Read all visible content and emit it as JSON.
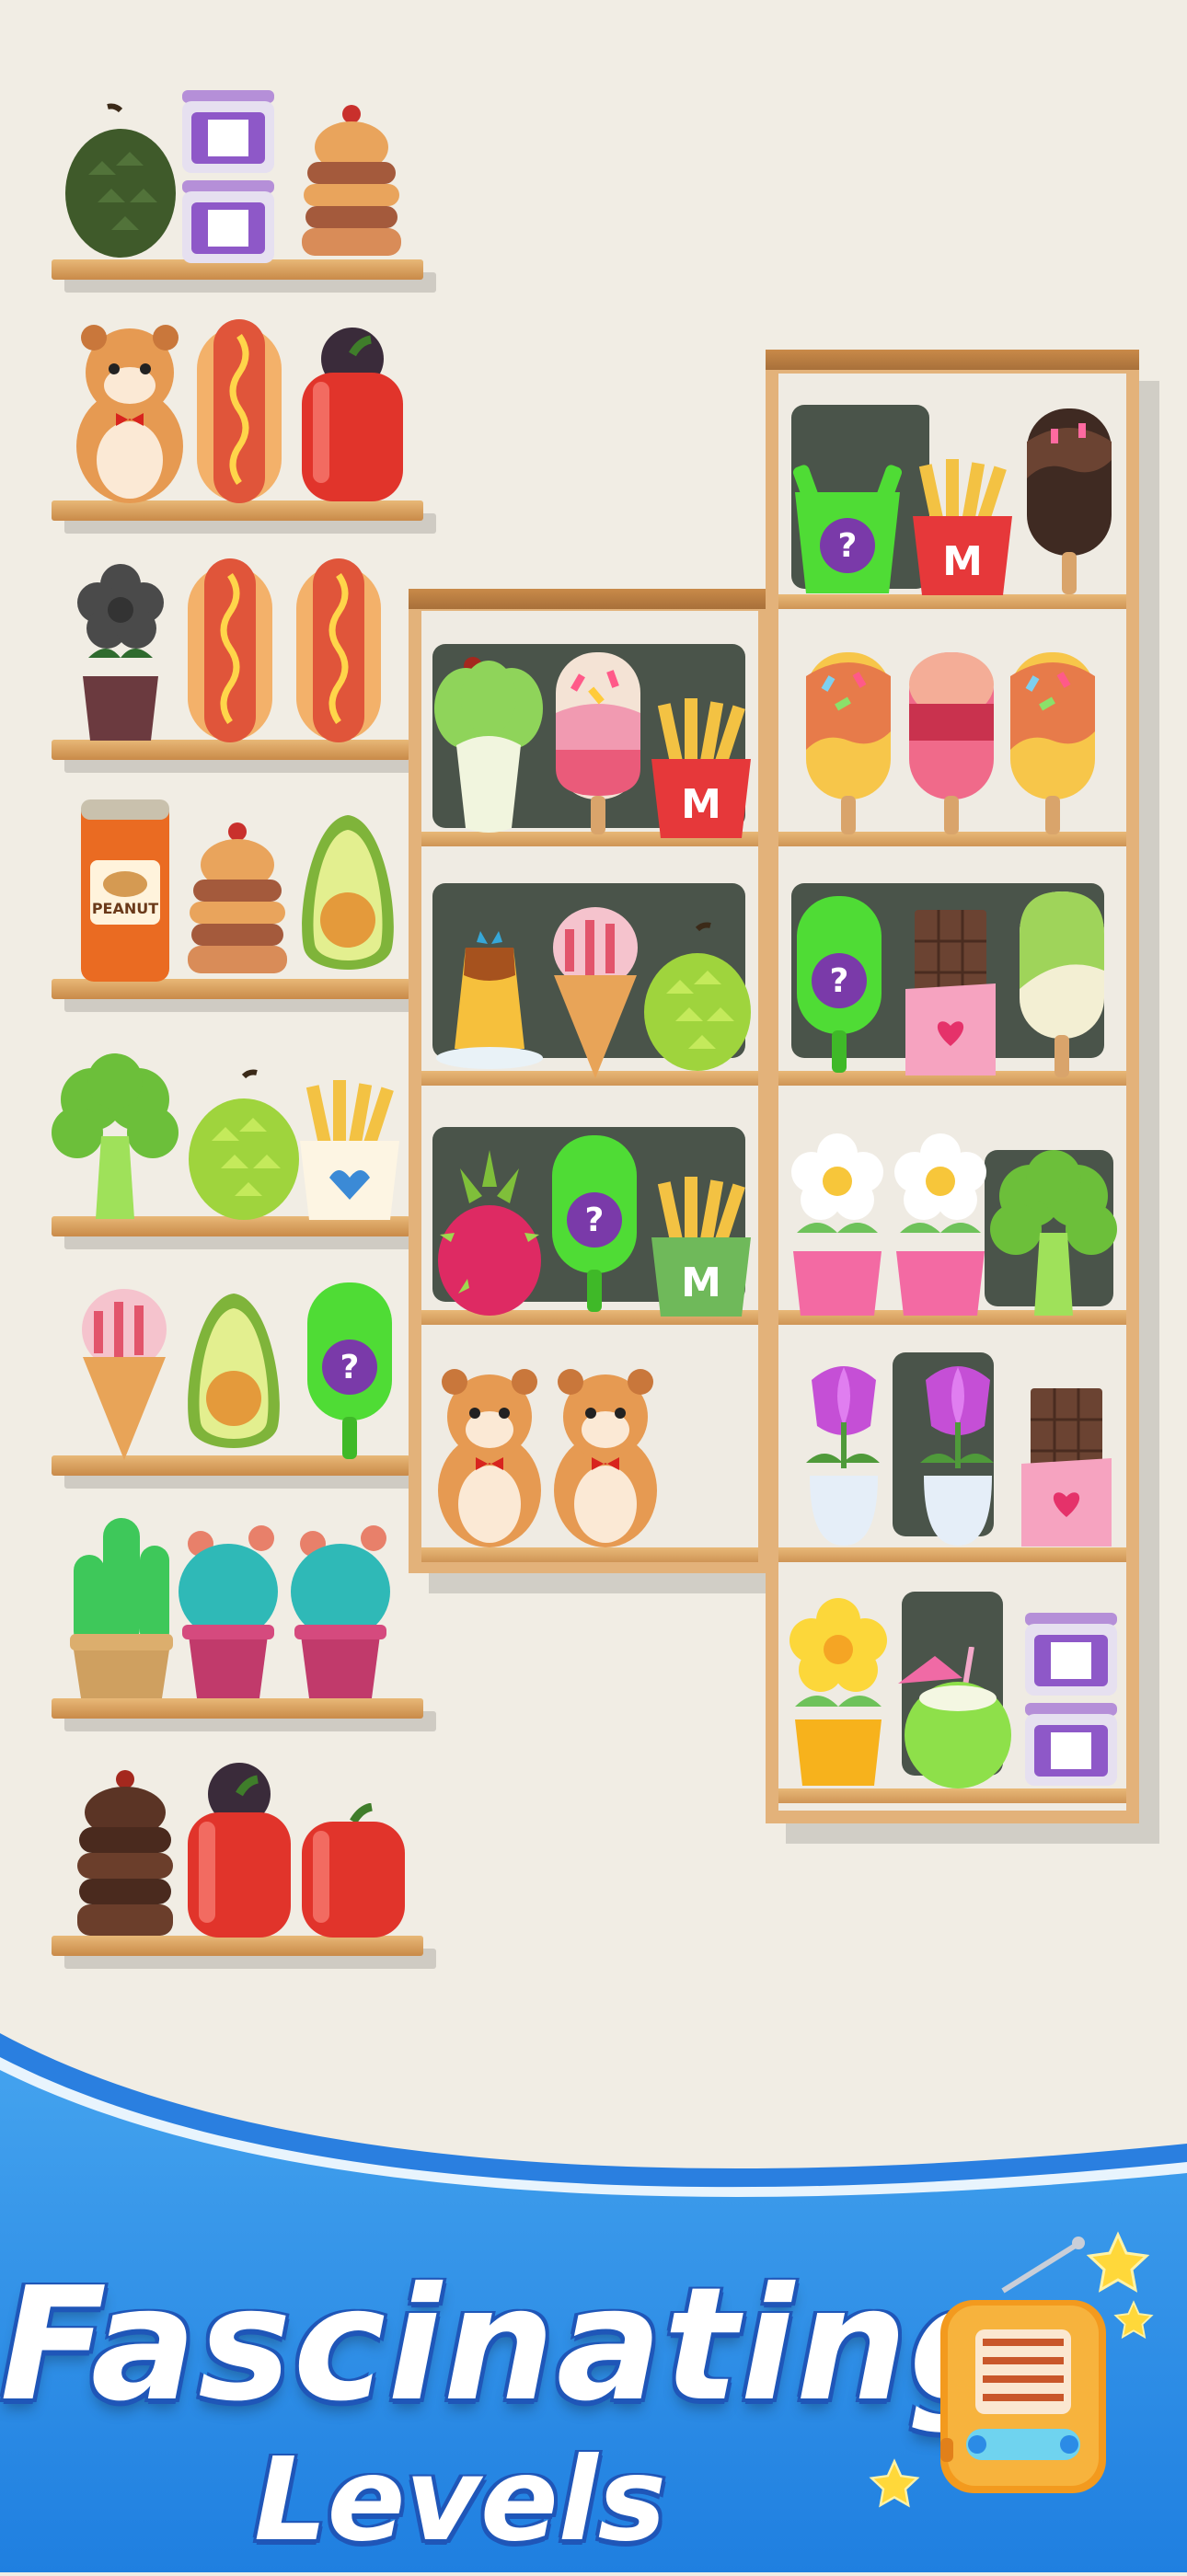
{
  "banner": {
    "title": "Fascinating",
    "subtitle": "Levels"
  },
  "question_mark": "?",
  "labels": {
    "peanut": "PEANUT",
    "fries_logo": "M"
  },
  "colors": {
    "background": "#f1ede4",
    "shelf_wood": "#e3b27a",
    "banner_blue": "#2b8be6",
    "title_outline": "#1f56b8"
  },
  "items": {
    "left_shelves": [
      [
        "durian-icon",
        "sugar-jar-stack-icon",
        "burger-stack-icon"
      ],
      [
        "hamster-icon",
        "hotdog-icon",
        "red-pepper-icon"
      ],
      [
        "potted-flower-icon",
        "hotdog-icon",
        "hotdog-icon"
      ],
      [
        "peanut-can-icon",
        "burger-stack-icon",
        "avocado-icon"
      ],
      [
        "broccoli-icon",
        "durian-icon",
        "fries-icon"
      ],
      [
        "ice-cream-cone-icon",
        "avocado-icon",
        "mystery-popsicle-icon"
      ],
      [
        "cactus-icon",
        "flowering-cactus-icon",
        "flowering-cactus-icon"
      ],
      [
        "chocolate-cake-icon",
        "red-pepper-icon",
        "red-pepper-icon"
      ]
    ],
    "middle_cabinet": [
      [
        "bok-choy-icon",
        "sprinkle-popsicle-icon",
        "fries-icon"
      ],
      [
        "pudding-icon",
        "ice-cream-cone-icon",
        "durian-icon"
      ],
      [
        "dragon-fruit-icon",
        "mystery-popsicle-icon",
        "fries-icon"
      ],
      [
        "hamster-icon",
        "hamster-icon"
      ]
    ],
    "right_cabinet": [
      [
        "mystery-fries-icon",
        "fries-icon",
        "chocolate-popsicle-icon"
      ],
      [
        "sprinkle-popsicle-icon",
        "strawberry-popsicle-icon",
        "sprinkle-popsicle-icon"
      ],
      [
        "mystery-popsicle-icon",
        "chocolate-bar-icon",
        "matcha-popsicle-icon"
      ],
      [
        "daisy-pot-icon",
        "daisy-pot-icon",
        "broccoli-icon"
      ],
      [
        "tulip-pot-icon",
        "tulip-pot-icon",
        "chocolate-bar-icon"
      ],
      [
        "yellow-flower-pot-icon",
        "coconut-drink-icon",
        "sugar-jar-stack-icon"
      ]
    ]
  }
}
